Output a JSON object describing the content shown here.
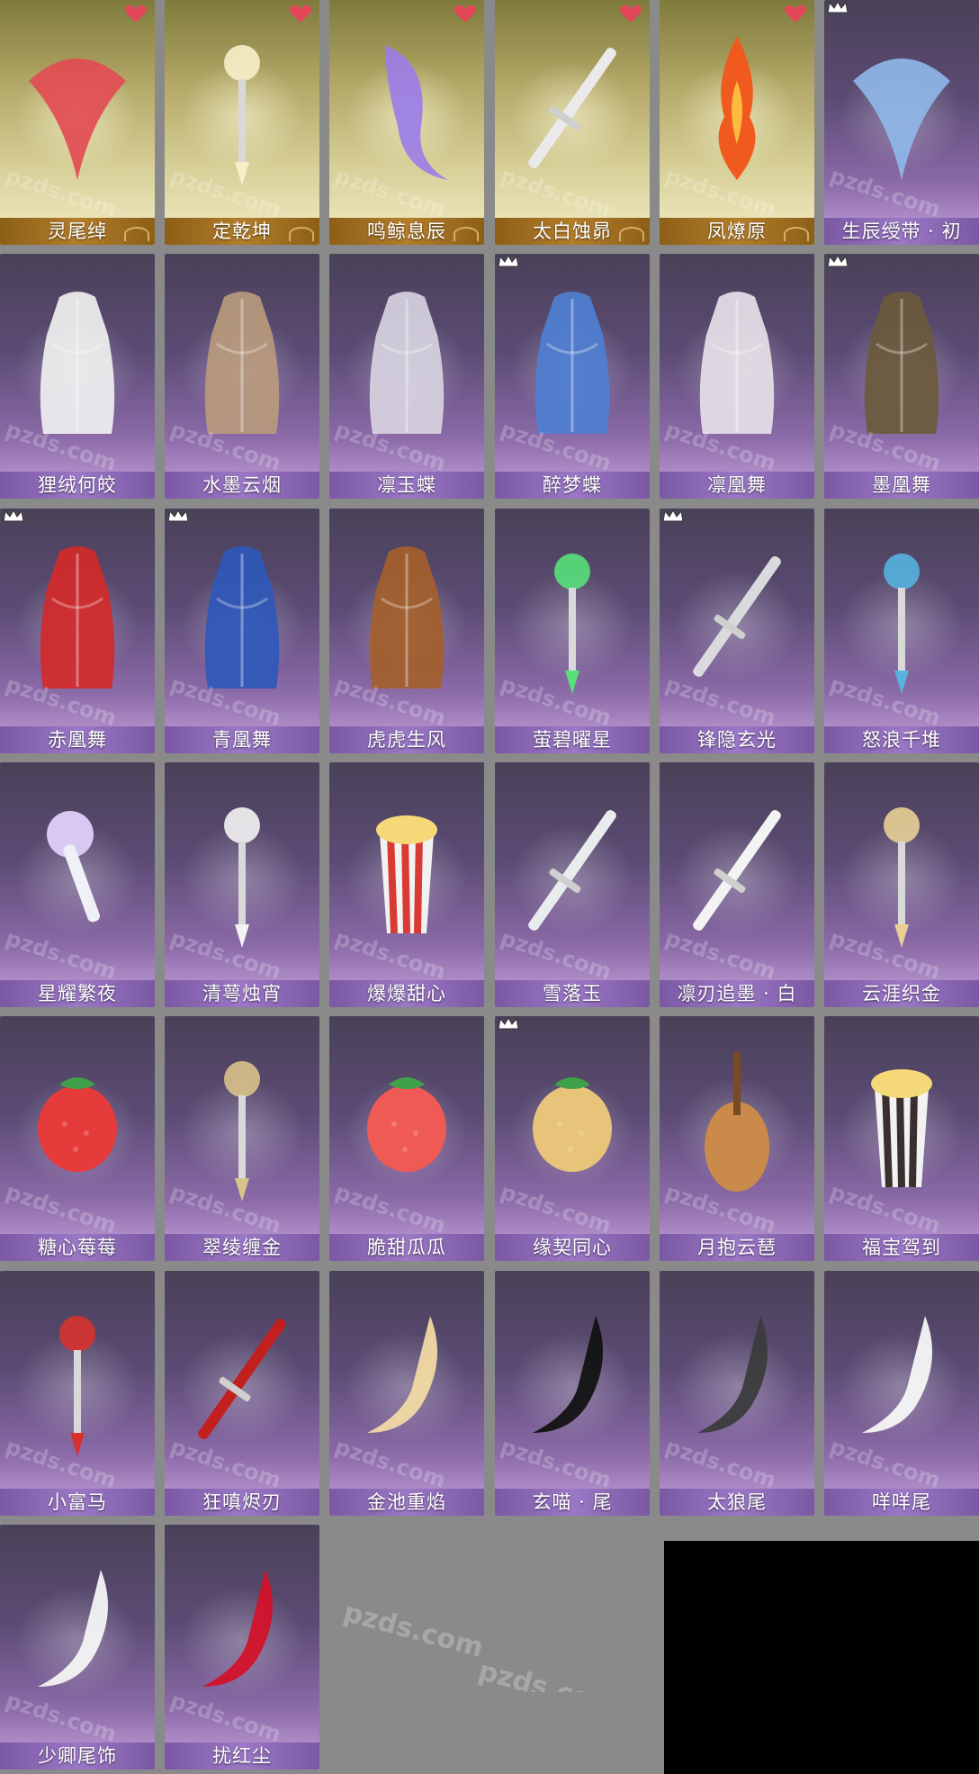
{
  "watermark": "pzds.com",
  "items": [
    {
      "name": "灵尾绰",
      "bg": "gold",
      "heart": true,
      "crown": false,
      "icon": "red-ribbon-icon",
      "color": "#e24a52"
    },
    {
      "name": "定乾坤",
      "bg": "gold",
      "heart": true,
      "crown": false,
      "icon": "golden-weapon-icon",
      "color": "#f7efc9"
    },
    {
      "name": "鸣鲸息辰",
      "bg": "gold",
      "heart": true,
      "crown": false,
      "icon": "purple-whale-icon",
      "color": "#9a7ce9"
    },
    {
      "name": "太白蚀昴",
      "bg": "gold",
      "heart": true,
      "crown": false,
      "icon": "crescent-sword-icon",
      "color": "#eaeaea"
    },
    {
      "name": "凤燎原",
      "bg": "gold",
      "heart": true,
      "crown": false,
      "icon": "flame-icon",
      "color": "#f05a1f"
    },
    {
      "name": "生辰绶带 · 初",
      "bg": "purple",
      "heart": false,
      "crown": true,
      "icon": "blue-sash-icon",
      "color": "#8fb8ea"
    },
    {
      "name": "狸绒何皎",
      "bg": "purple",
      "heart": false,
      "crown": false,
      "icon": "white-hair-icon",
      "color": "#f0f0f0"
    },
    {
      "name": "水墨云烟",
      "bg": "purple",
      "heart": false,
      "crown": false,
      "icon": "ink-robe-icon",
      "color": "#b89a7d"
    },
    {
      "name": "凛玉蝶",
      "bg": "purple",
      "heart": false,
      "crown": false,
      "icon": "silver-robe-icon",
      "color": "#d7d3df"
    },
    {
      "name": "醉梦蝶",
      "bg": "purple",
      "heart": false,
      "crown": true,
      "icon": "blue-robe-icon",
      "color": "#4f7fd1"
    },
    {
      "name": "凛凰舞",
      "bg": "purple",
      "heart": false,
      "crown": false,
      "icon": "white-robe-icon",
      "color": "#e6e1e8"
    },
    {
      "name": "墨凰舞",
      "bg": "purple",
      "heart": false,
      "crown": true,
      "icon": "dark-robe-icon",
      "color": "#6b5a3c"
    },
    {
      "name": "赤凰舞",
      "bg": "purple",
      "heart": false,
      "crown": true,
      "icon": "red-robe-icon",
      "color": "#d22a2a"
    },
    {
      "name": "青凰舞",
      "bg": "purple",
      "heart": false,
      "crown": true,
      "icon": "azure-robe-icon",
      "color": "#2f58b8"
    },
    {
      "name": "虎虎生风",
      "bg": "purple",
      "heart": false,
      "crown": false,
      "icon": "tiger-suit-icon",
      "color": "#a45f2b"
    },
    {
      "name": "萤碧曜星",
      "bg": "purple",
      "heart": false,
      "crown": false,
      "icon": "star-wand-icon",
      "color": "#57e07a"
    },
    {
      "name": "锋隐玄光",
      "bg": "purple",
      "heart": false,
      "crown": true,
      "icon": "dagger-icon",
      "color": "#d9d9de"
    },
    {
      "name": "怒浪千堆",
      "bg": "purple",
      "heart": false,
      "crown": false,
      "icon": "ornate-staff-icon",
      "color": "#57b2e0"
    },
    {
      "name": "星耀繁夜",
      "bg": "purple",
      "heart": false,
      "crown": false,
      "icon": "microphone-icon",
      "color": "#d9c8f2"
    },
    {
      "name": "清萼烛宵",
      "bg": "purple",
      "heart": false,
      "crown": false,
      "icon": "lotus-ornament-icon",
      "color": "#f3f3f3"
    },
    {
      "name": "爆爆甜心",
      "bg": "purple",
      "heart": false,
      "crown": false,
      "icon": "popcorn-icon",
      "color": "#d83b33"
    },
    {
      "name": "雪落玉",
      "bg": "purple",
      "heart": false,
      "crown": false,
      "icon": "jade-flute-icon",
      "color": "#e8ecec"
    },
    {
      "name": "凛刃追墨 · 白",
      "bg": "purple",
      "heart": false,
      "crown": false,
      "icon": "white-sword-icon",
      "color": "#f3f3f3"
    },
    {
      "name": "云涯织金",
      "bg": "purple",
      "heart": false,
      "crown": false,
      "icon": "tassel-charm-icon",
      "color": "#e7cf95"
    },
    {
      "name": "糖心莓莓",
      "bg": "purple",
      "heart": false,
      "crown": false,
      "icon": "strawberry-icon",
      "color": "#e63b3b"
    },
    {
      "name": "翠绫缠金",
      "bg": "purple",
      "heart": false,
      "crown": false,
      "icon": "jade-tassel-icon",
      "color": "#d9c28b"
    },
    {
      "name": "脆甜瓜瓜",
      "bg": "purple",
      "heart": false,
      "crown": false,
      "icon": "watermelon-icon",
      "color": "#ef5a55"
    },
    {
      "name": "缘契同心",
      "bg": "purple",
      "heart": false,
      "crown": true,
      "icon": "heart-pendant-icon",
      "color": "#e8c47a"
    },
    {
      "name": "月抱云琶",
      "bg": "purple",
      "heart": false,
      "crown": false,
      "icon": "pipa-icon",
      "color": "#c98a4a"
    },
    {
      "name": "福宝驾到",
      "bg": "purple",
      "heart": false,
      "crown": false,
      "icon": "gift-box-icon",
      "color": "#3a2f2f"
    },
    {
      "name": "小富马",
      "bg": "purple",
      "heart": false,
      "crown": false,
      "icon": "horse-charm-icon",
      "color": "#d8322f"
    },
    {
      "name": "狂嗔烬刃",
      "bg": "purple",
      "heart": false,
      "crown": false,
      "icon": "flame-spear-icon",
      "color": "#c21f1f"
    },
    {
      "name": "金池重焰",
      "bg": "purple",
      "heart": false,
      "crown": false,
      "icon": "golden-tail-icon",
      "color": "#f1d9a3"
    },
    {
      "name": "玄喵 · 尾",
      "bg": "purple",
      "heart": false,
      "crown": false,
      "icon": "black-cat-tail-icon",
      "color": "#121212"
    },
    {
      "name": "太狼尾",
      "bg": "purple",
      "heart": false,
      "crown": false,
      "icon": "wolf-tail-icon",
      "color": "#3b3b3b"
    },
    {
      "name": "咩咩尾",
      "bg": "purple",
      "heart": false,
      "crown": false,
      "icon": "white-tail-icon",
      "color": "#f7f7f7"
    },
    {
      "name": "少卿尾饰",
      "bg": "purple",
      "heart": false,
      "crown": false,
      "icon": "white-long-tail-icon",
      "color": "#f4f4f4"
    },
    {
      "name": "扰红尘",
      "bg": "purple",
      "heart": false,
      "crown": false,
      "icon": "red-fox-tail-icon",
      "color": "#d3122a"
    }
  ]
}
